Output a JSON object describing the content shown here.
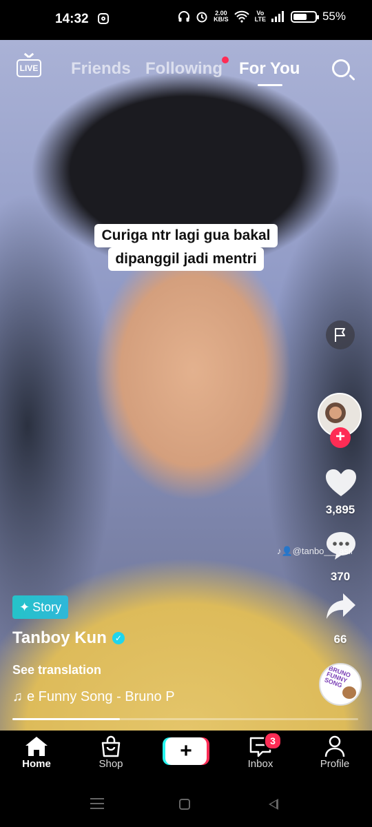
{
  "status_bar": {
    "time": "14:32",
    "speed_value": "2.00",
    "speed_unit": "KB/S",
    "network_label_top": "Vo",
    "network_label_bottom": "LTE",
    "battery": "55%",
    "icons": [
      "instagram-icon",
      "headphones-icon",
      "alarm-icon",
      "wifi-icon",
      "signal-icon",
      "battery-icon"
    ]
  },
  "top_nav": {
    "live_label": "LIVE",
    "tabs": [
      {
        "label": "Friends",
        "active": false
      },
      {
        "label": "Following",
        "active": false,
        "dot": true
      },
      {
        "label": "For You",
        "active": true
      }
    ]
  },
  "video": {
    "caption_line1": "Curiga ntr lagi gua bakal",
    "caption_line2": "dipanggil jadi mentri",
    "watermark": "♪👤@tanbo___asli"
  },
  "right_rail": {
    "likes": "3,895",
    "comments": "370",
    "shares": "66",
    "disc_text": "BRUNO FUNNY SONG"
  },
  "post_info": {
    "story_label": "Story",
    "username": "Tanboy Kun",
    "see_translation": "See translation",
    "music": "e Funny Song - Bruno P",
    "progress": 0.31
  },
  "bottom_nav": {
    "items": [
      {
        "label": "Home",
        "active": true
      },
      {
        "label": "Shop",
        "active": false
      },
      {
        "label": "Inbox",
        "active": false,
        "badge": "3"
      },
      {
        "label": "Profile",
        "active": false
      }
    ]
  },
  "colors": {
    "accent_red": "#fe2c55",
    "accent_cyan": "#25f4ee",
    "story_teal": "#25c3c9",
    "verified_blue": "#20d5ec"
  }
}
